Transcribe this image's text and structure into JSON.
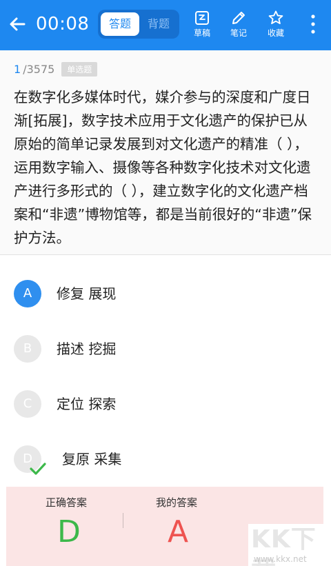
{
  "header": {
    "timer": "00:08",
    "tabs": [
      {
        "label": "答题",
        "active": true
      },
      {
        "label": "背题",
        "active": false
      }
    ],
    "tools": [
      {
        "label": "草稿",
        "icon": "draft-icon"
      },
      {
        "label": "笔记",
        "icon": "pencil-icon"
      },
      {
        "label": "收藏",
        "icon": "star-icon"
      }
    ],
    "accent_color": "#1e88f0"
  },
  "question": {
    "number": "1",
    "total": "/3575",
    "type": "单选题",
    "text": "在数字化多媒体时代，媒介参与的深度和广度日渐[拓展]，数字技术应用于文化遗产的保护已从原始的简单记录发展到对文化遗产的精准（ ），运用数字输入、摄像等各种数字化技术对文化遗产进行多形式的（ ），建立数字化的文化遗产档案和“非遗”博物馆等，都是当前很好的“非遗”保护方法。"
  },
  "options": [
    {
      "letter": "A",
      "text": "修复 展现",
      "selected": true
    },
    {
      "letter": "B",
      "text": "描述 挖掘",
      "selected": false
    },
    {
      "letter": "C",
      "text": "定位 探索",
      "selected": false
    },
    {
      "letter": "D",
      "text": "复原 采集",
      "selected": false,
      "correct": true
    }
  ],
  "answer": {
    "correct_label": "正确答案",
    "correct_value": "D",
    "correct_color": "#3cb84a",
    "mine_label": "我的答案",
    "mine_value": "A",
    "mine_color": "#ee5350"
  },
  "watermark": {
    "text": "KK下载",
    "url": "www.kkx.net"
  }
}
